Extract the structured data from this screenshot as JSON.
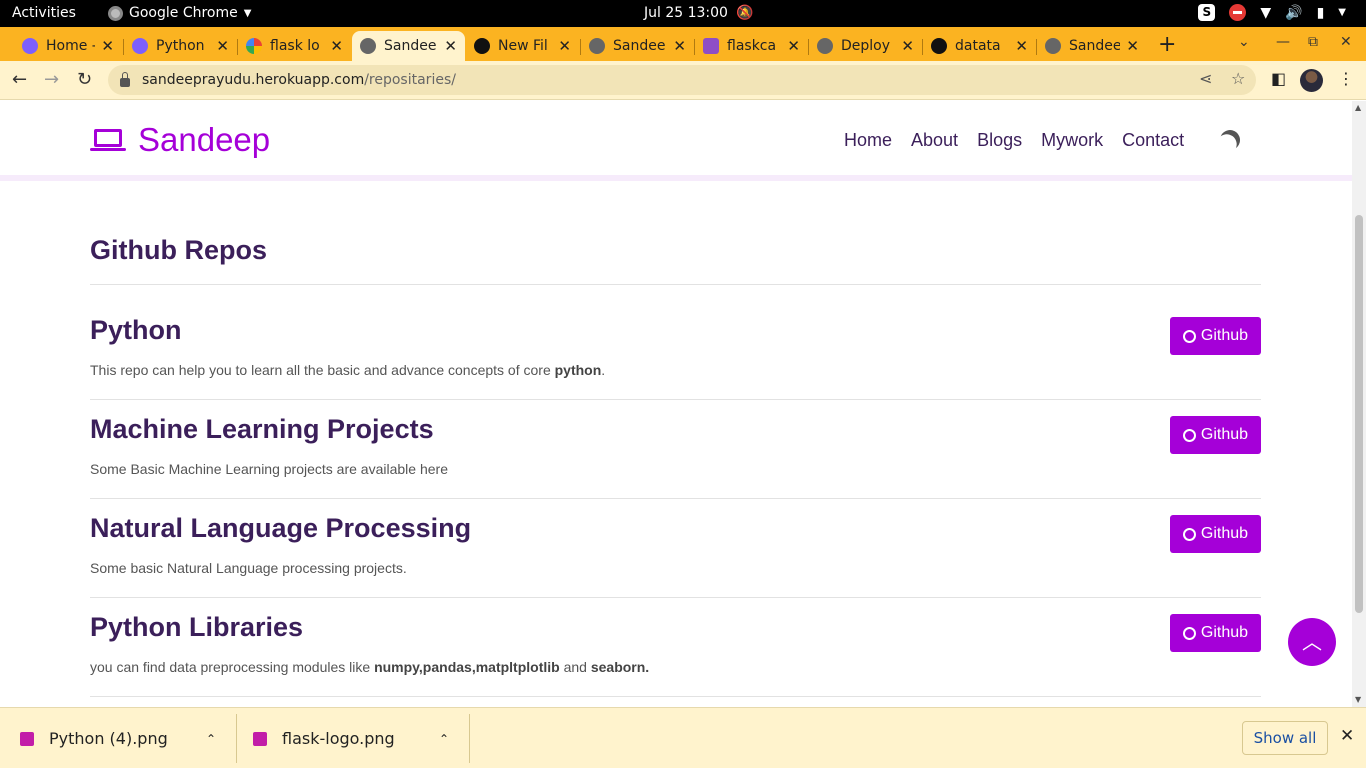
{
  "os_bar": {
    "activities": "Activities",
    "app_name": "Google Chrome",
    "clock": "Jul 25  13:00"
  },
  "tabs": [
    {
      "title": "Home -",
      "icon": "canva-icon",
      "active": false
    },
    {
      "title": "Python",
      "icon": "canva-icon",
      "active": false
    },
    {
      "title": "flask lo",
      "icon": "google-icon",
      "active": false
    },
    {
      "title": "Sandee",
      "icon": "globe-icon",
      "active": true
    },
    {
      "title": "New Fil",
      "icon": "github-icon",
      "active": false
    },
    {
      "title": "Sandee",
      "icon": "globe-icon",
      "active": false
    },
    {
      "title": "flaskca",
      "icon": "heroku-icon",
      "active": false
    },
    {
      "title": "Deploy",
      "icon": "globe-icon",
      "active": false
    },
    {
      "title": "datata",
      "icon": "github-icon",
      "active": false
    },
    {
      "title": "Sandee",
      "icon": "globe-icon",
      "active": false
    }
  ],
  "address_bar": {
    "host": "sandeeprayudu.herokuapp.com",
    "path": "/repositaries/"
  },
  "site": {
    "brand": "Sandeep",
    "nav": [
      "Home",
      "About",
      "Blogs",
      "Mywork",
      "Contact"
    ],
    "section_title": "Github Repos",
    "button_label": "Github",
    "repos": [
      {
        "title": "Python",
        "desc_before": "This repo can help you to learn all the basic and advance concepts of core ",
        "desc_bold": "python",
        "desc_after": ".",
        "desc_bold2": "",
        "desc_after2": ""
      },
      {
        "title": "Machine Learning Projects",
        "desc_before": "Some Basic Machine Learning projects are available here",
        "desc_bold": "",
        "desc_after": "",
        "desc_bold2": "",
        "desc_after2": ""
      },
      {
        "title": "Natural Language Processing",
        "desc_before": "Some basic Natural Language processing projects.",
        "desc_bold": "",
        "desc_after": "",
        "desc_bold2": "",
        "desc_after2": ""
      },
      {
        "title": "Python Libraries",
        "desc_before": "you can find data preprocessing modules like ",
        "desc_bold": "numpy,pandas,matpltplotlib",
        "desc_after": " and ",
        "desc_bold2": "seaborn.",
        "desc_after2": ""
      }
    ]
  },
  "downloads": {
    "items": [
      "Python (4).png",
      "flask-logo.png"
    ],
    "show_all": "Show all"
  },
  "colors": {
    "accent": "#a500d8",
    "heading": "#3b1f5a",
    "chrome_frame": "#fbb321",
    "chrome_toolbar": "#fff3cd"
  }
}
